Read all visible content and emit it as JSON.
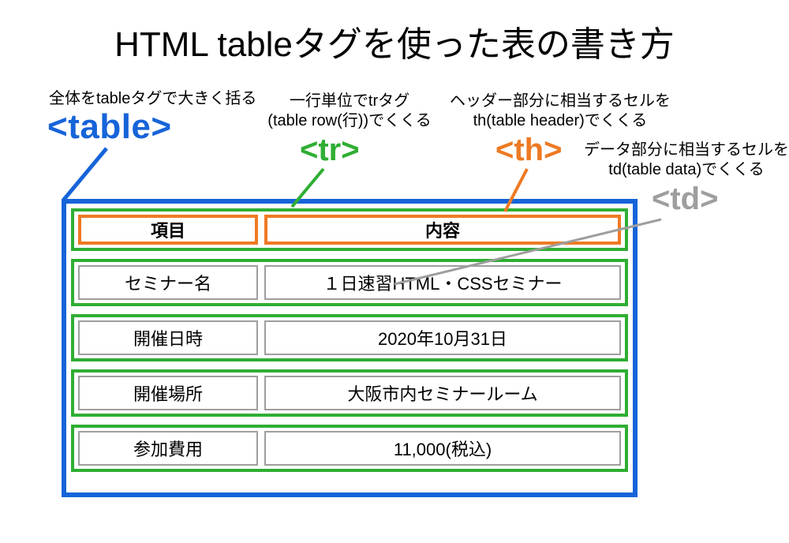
{
  "title": "HTML tableタグを使った表の書き方",
  "annotations": {
    "table": {
      "desc": "全体をtableタグで大きく括る",
      "tag": "<table>"
    },
    "tr": {
      "desc_line1": "一行単位でtrタグ",
      "desc_line2": "(table row(行))でくくる",
      "tag": "<tr>"
    },
    "th": {
      "desc_line1": "ヘッダー部分に相当するセルを",
      "desc_line2": "th(table header)でくくる",
      "tag": "<th>"
    },
    "td": {
      "desc_line1": "データ部分に相当するセルを",
      "desc_line2": "td(table data)でくくる",
      "tag": "<td>"
    }
  },
  "table_content": {
    "headers": {
      "col1": "項目",
      "col2": "内容"
    },
    "rows": [
      {
        "col1": "セミナー名",
        "col2": "１日速習HTML・CSSセミナー"
      },
      {
        "col1": "開催日時",
        "col2": "2020年10月31日"
      },
      {
        "col1": "開催場所",
        "col2": "大阪市内セミナールーム"
      },
      {
        "col1": "参加費用",
        "col2": "11,000(税込)"
      }
    ]
  },
  "colors": {
    "table_tag": "#1664d9",
    "tr_tag": "#2fae33",
    "th_tag": "#ee7a23",
    "td_tag": "#9e9e9e"
  }
}
